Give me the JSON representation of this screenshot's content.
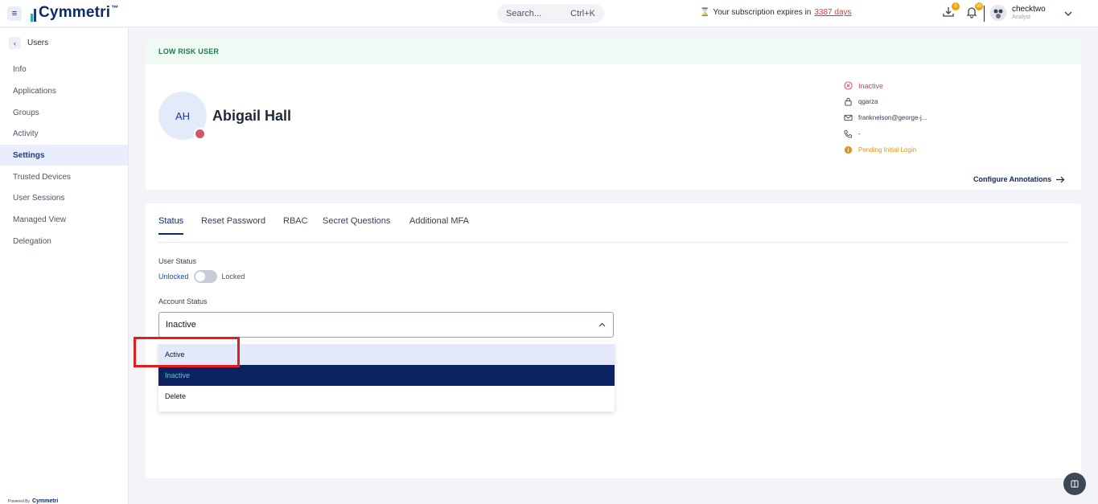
{
  "topbar": {
    "logo_text": "Cymmetri",
    "logo_tm": "™",
    "search_placeholder": "Search...",
    "search_shortcut": "Ctrl+K",
    "subscription_prefix": "Your subscription expires in",
    "subscription_days": "3387 days",
    "downloads_badge": "5",
    "notifications_badge": "99",
    "user_name": "checktwo",
    "user_role": "Analyst",
    "icons": [
      "menu-icon",
      "hourglass-icon",
      "download-icon",
      "bell-icon",
      "chevron-down-icon"
    ]
  },
  "sidebar": {
    "back_label": "Users",
    "items": [
      {
        "label": "Info"
      },
      {
        "label": "Applications"
      },
      {
        "label": "Groups"
      },
      {
        "label": "Activity"
      },
      {
        "label": "Settings",
        "active": true
      },
      {
        "label": "Trusted Devices"
      },
      {
        "label": "User Sessions"
      },
      {
        "label": "Managed View"
      },
      {
        "label": "Delegation"
      }
    ],
    "powered_by": "Powered By",
    "powered_brand": "Cymmetri"
  },
  "profile": {
    "risk_label": "LOW RISK USER",
    "initials": "AH",
    "name": "Abigail Hall",
    "status": "Inactive",
    "username": "qgarza",
    "email": "franknelson@george-j...",
    "phone": "-",
    "login_state": "Pending Initial Login",
    "configure_label": "Configure Annotations",
    "colors": {
      "status_dot": "#d9536a",
      "inactive": "#d2475a",
      "pending": "#e2921c"
    }
  },
  "settings": {
    "tabs": [
      {
        "label": "Status",
        "active": true
      },
      {
        "label": "Reset Password"
      },
      {
        "label": "RBAC"
      },
      {
        "label": "Secret Questions"
      },
      {
        "label": "Additional MFA"
      }
    ],
    "user_status_label": "User Status",
    "unlocked_label": "Unlocked",
    "locked_label": "Locked",
    "account_status_label": "Account Status",
    "account_status_value": "Inactive",
    "options": [
      {
        "label": "Active",
        "state": "hover"
      },
      {
        "label": "Inactive",
        "state": "selected"
      },
      {
        "label": "Delete"
      }
    ]
  }
}
